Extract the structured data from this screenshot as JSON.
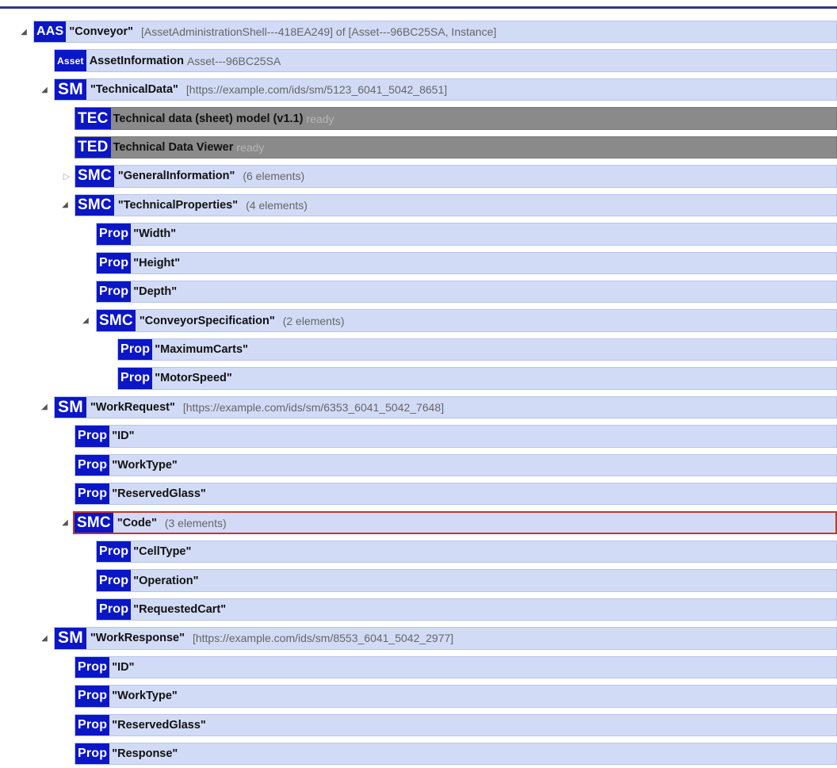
{
  "tree": {
    "rows": [
      {
        "badge": "AAS",
        "name": "\"Conveyor\"",
        "extra": "[AssetAdministrationShell---418EA249] of [Asset---96BC25SA, Instance]"
      },
      {
        "badge": "Asset",
        "name": "AssetInformation",
        "extra": "Asset---96BC25SA"
      },
      {
        "badge": "SM",
        "name": "\"TechnicalData\"",
        "extra": "[https://example.com/ids/sm/5123_6041_5042_8651]"
      },
      {
        "badge": "TEC",
        "name": "Technical data (sheet) model (v1.1)",
        "extra": "ready"
      },
      {
        "badge": "TED",
        "name": "Technical Data Viewer",
        "extra": "ready"
      },
      {
        "badge": "SMC",
        "name": "\"GeneralInformation\"",
        "extra": "(6 elements)"
      },
      {
        "badge": "SMC",
        "name": "\"TechnicalProperties\"",
        "extra": "(4 elements)"
      },
      {
        "badge": "Prop",
        "name": "\"Width\"",
        "extra": ""
      },
      {
        "badge": "Prop",
        "name": "\"Height\"",
        "extra": ""
      },
      {
        "badge": "Prop",
        "name": "\"Depth\"",
        "extra": ""
      },
      {
        "badge": "SMC",
        "name": "\"ConveyorSpecification\"",
        "extra": "(2 elements)"
      },
      {
        "badge": "Prop",
        "name": "\"MaximumCarts\"",
        "extra": ""
      },
      {
        "badge": "Prop",
        "name": "\"MotorSpeed\"",
        "extra": ""
      },
      {
        "badge": "SM",
        "name": "\"WorkRequest\"",
        "extra": "[https://example.com/ids/sm/6353_6041_5042_7648]"
      },
      {
        "badge": "Prop",
        "name": "\"ID\"",
        "extra": ""
      },
      {
        "badge": "Prop",
        "name": "\"WorkType\"",
        "extra": ""
      },
      {
        "badge": "Prop",
        "name": "\"ReservedGlass\"",
        "extra": ""
      },
      {
        "badge": "SMC",
        "name": "\"Code\"",
        "extra": "(3 elements)"
      },
      {
        "badge": "Prop",
        "name": "\"CellType\"",
        "extra": ""
      },
      {
        "badge": "Prop",
        "name": "\"Operation\"",
        "extra": ""
      },
      {
        "badge": "Prop",
        "name": "\"RequestedCart\"",
        "extra": ""
      },
      {
        "badge": "SM",
        "name": "\"WorkResponse\"",
        "extra": "[https://example.com/ids/sm/8553_6041_5042_2977]"
      },
      {
        "badge": "Prop",
        "name": "\"ID\"",
        "extra": ""
      },
      {
        "badge": "Prop",
        "name": "\"WorkType\"",
        "extra": ""
      },
      {
        "badge": "Prop",
        "name": "\"ReservedGlass\"",
        "extra": ""
      },
      {
        "badge": "Prop",
        "name": "\"Response\"",
        "extra": ""
      }
    ]
  },
  "colors": {
    "badge": "#0b16c7",
    "row": "#d2dbf6",
    "plugin_row": "#8a8a8a",
    "selected_border": "#c0392b"
  }
}
